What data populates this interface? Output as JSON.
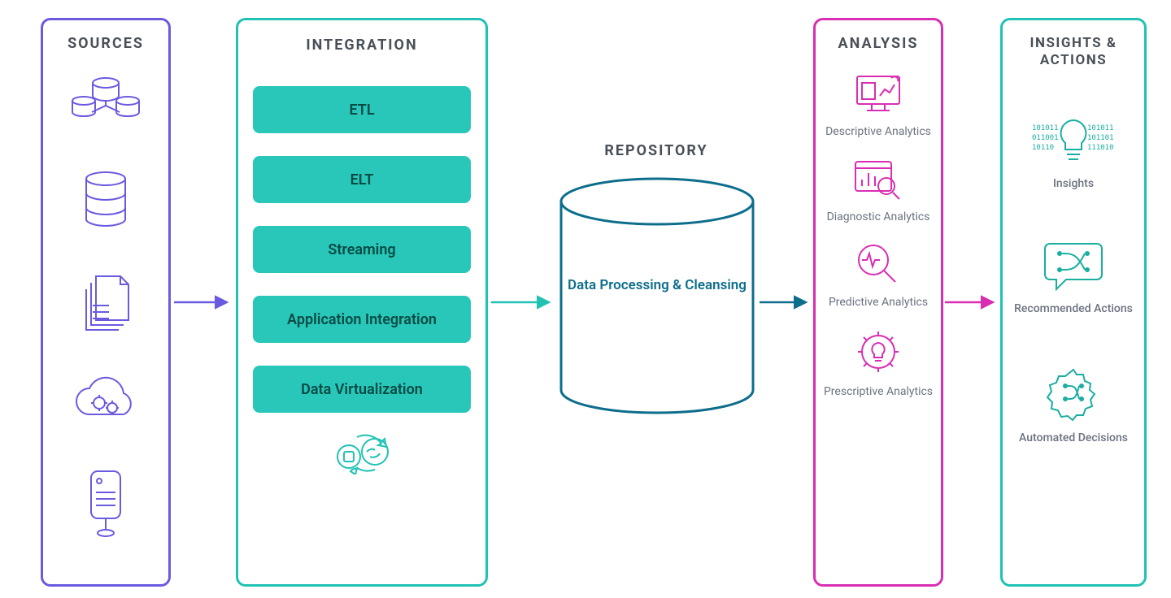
{
  "sources": {
    "title": "SOURCES",
    "icons": [
      "databases-cluster",
      "database",
      "documents",
      "cloud-gears",
      "server"
    ]
  },
  "integration": {
    "title": "INTEGRATION",
    "items": [
      "ETL",
      "ELT",
      "Streaming",
      "Application Integration",
      "Data Virtualization"
    ],
    "footer_icon": "transform-cycle"
  },
  "repository": {
    "title": "REPOSITORY",
    "label": "Data Processing & Cleansing"
  },
  "analysis": {
    "title": "ANALYSIS",
    "items": [
      {
        "icon": "dashboard",
        "label": "Descriptive Analytics"
      },
      {
        "icon": "chart-magnify",
        "label": "Diagnostic Analytics"
      },
      {
        "icon": "pulse-magnify",
        "label": "Predictive Analytics"
      },
      {
        "icon": "gear-lightbulb",
        "label": "Prescriptive Analytics"
      }
    ]
  },
  "insights": {
    "title": "INSIGHTS & ACTIONS",
    "items": [
      {
        "icon": "lightbulb-binary",
        "label": "Insights"
      },
      {
        "icon": "flow-speech",
        "label": "Recommended Actions"
      },
      {
        "icon": "gear-flow",
        "label": "Automated Decisions"
      }
    ]
  },
  "colors": {
    "purple": "#6a5ae0",
    "teal": "#1fc2b3",
    "blue": "#0d6e8c",
    "magenta": "#d92eb3",
    "gray": "#4a5058"
  }
}
